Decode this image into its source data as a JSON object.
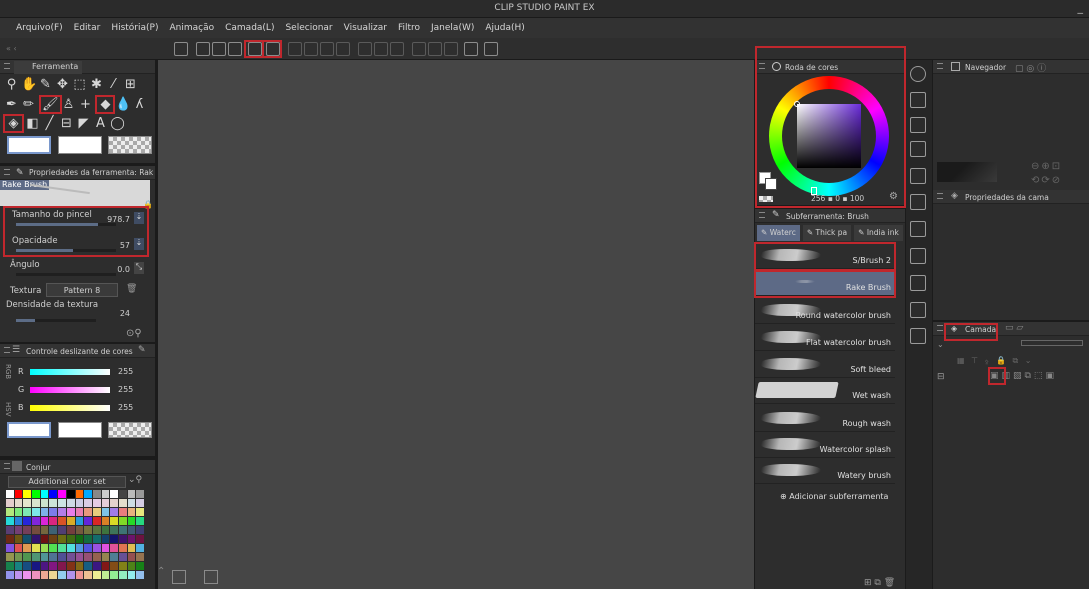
{
  "app": {
    "title": "CLIP STUDIO PAINT EX",
    "window_min": "_",
    "window_max": "□"
  },
  "menu": [
    "Arquivo(F)",
    "Editar",
    "História(P)",
    "Animação",
    "Camada(L)",
    "Selecionar",
    "Visualizar",
    "Filtro",
    "Janela(W)",
    "Ajuda(H)"
  ],
  "tool_panel": {
    "title": "Ferramenta"
  },
  "tool_props": {
    "title": "Propriedades da ferramenta: Rake B",
    "preset_name": "Rake Brush",
    "rows": [
      {
        "label": "Tamanho do pincel",
        "value": "978.7",
        "fill": 0.82
      },
      {
        "label": "Opacidade",
        "value": "57",
        "fill": 0.57
      },
      {
        "label": "Ângulo",
        "value": "0.0",
        "fill": 0.0
      },
      {
        "label": "Textura",
        "value": "Pattern 8",
        "fill": 0.0
      },
      {
        "label": "Densidade da textura",
        "value": "24",
        "fill": 0.24
      }
    ]
  },
  "color_slider": {
    "title": "Controle deslizante de cores",
    "side_labels": "RGB",
    "side_labels2": "HSV",
    "rows": [
      {
        "label": "R",
        "value": "255"
      },
      {
        "label": "G",
        "value": "255"
      },
      {
        "label": "B",
        "value": "255"
      }
    ]
  },
  "color_set": {
    "title": "Conjur",
    "set_name": "Additional color set"
  },
  "color_wheel": {
    "title": "Roda de cores",
    "readout_h": "256",
    "readout_s": "0",
    "readout_v": "100"
  },
  "subtool": {
    "title": "Subferramenta: Brush",
    "tabs": [
      "Waterc",
      "Thick pa",
      "India ink"
    ],
    "items": [
      "S/Brush 2",
      "Rake Brush",
      "Round watercolor brush",
      "Flat watercolor brush",
      "Soft bleed",
      "Wet wash",
      "Rough wash",
      "Watercolor splash",
      "Watery brush"
    ],
    "selected_index": 1,
    "add_label": "Adicionar subferramenta"
  },
  "navigator": {
    "title": "Navegador"
  },
  "layer_props": {
    "title": "Propriedades da cama"
  },
  "layer": {
    "title": "Camada"
  },
  "colors": {
    "accent_red": "#c0272d",
    "selection_blue": "#5d6a86",
    "canvas": "#464646"
  }
}
